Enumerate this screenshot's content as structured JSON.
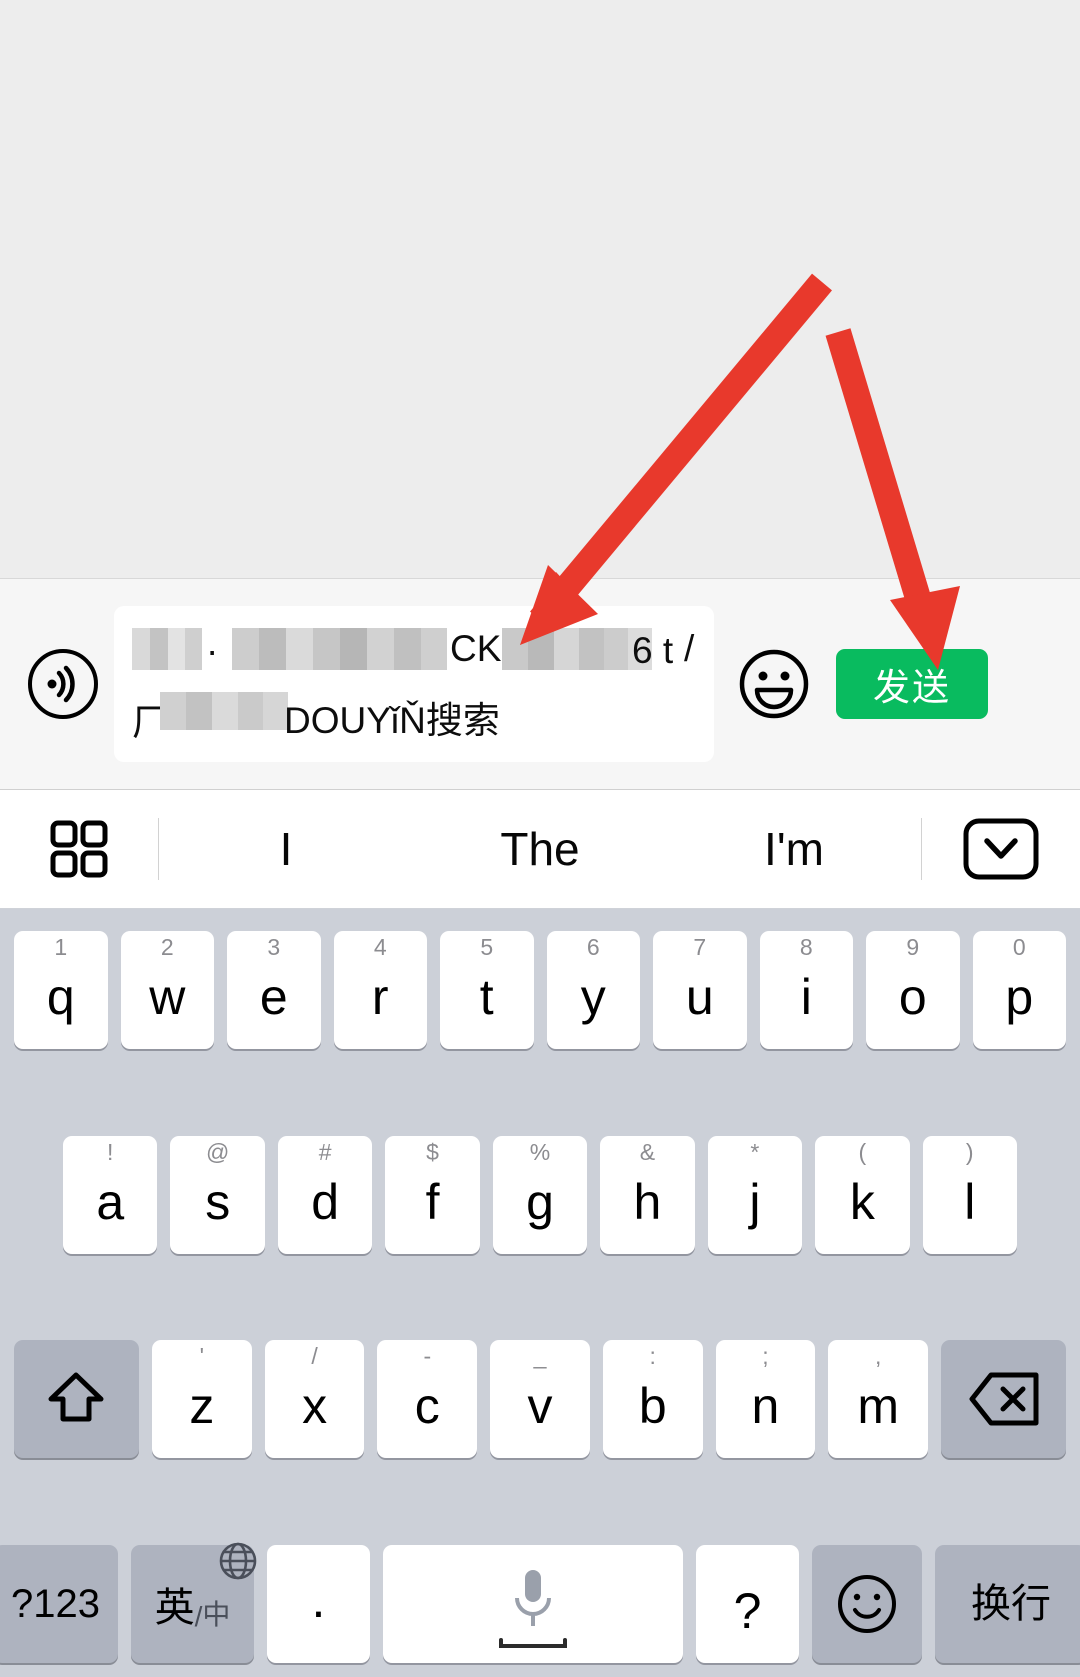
{
  "app": {
    "name": "wechat-chat-input",
    "accent_green": "#09bb5f",
    "keyboard_bg": "#ccd0d8",
    "key_fn_bg": "#aeb3bf",
    "arrow_color": "#e8392c"
  },
  "chat": {
    "background": "#ededed",
    "messages": []
  },
  "input_bar": {
    "voice_icon": "voice-wave-icon",
    "emoji_icon": "smiley-face-icon",
    "send_label": "发送",
    "composed_text": {
      "line1_visible_fragments": [
        "·",
        "CK",
        "6 t",
        "/"
      ],
      "line2_visible_fragments": [
        "厂",
        "DOUYǐŇ搜索"
      ],
      "redacted": true
    }
  },
  "suggestions": {
    "grid_icon": "grid-apps-icon",
    "words": [
      "I",
      "The",
      "I'm"
    ],
    "collapse_icon": "chevron-down-box-icon"
  },
  "keyboard": {
    "row1": [
      {
        "hint": "1",
        "main": "q"
      },
      {
        "hint": "2",
        "main": "w"
      },
      {
        "hint": "3",
        "main": "e"
      },
      {
        "hint": "4",
        "main": "r"
      },
      {
        "hint": "5",
        "main": "t"
      },
      {
        "hint": "6",
        "main": "y"
      },
      {
        "hint": "7",
        "main": "u"
      },
      {
        "hint": "8",
        "main": "i"
      },
      {
        "hint": "9",
        "main": "o"
      },
      {
        "hint": "0",
        "main": "p"
      }
    ],
    "row2": [
      {
        "hint": "!",
        "main": "a"
      },
      {
        "hint": "@",
        "main": "s"
      },
      {
        "hint": "#",
        "main": "d"
      },
      {
        "hint": "$",
        "main": "f"
      },
      {
        "hint": "%",
        "main": "g"
      },
      {
        "hint": "&",
        "main": "h"
      },
      {
        "hint": "*",
        "main": "j"
      },
      {
        "hint": "(",
        "main": "k"
      },
      {
        "hint": ")",
        "main": "l"
      }
    ],
    "row3": {
      "shift_icon": "shift-up-arrow-icon",
      "keys": [
        {
          "hint": "'",
          "main": "z"
        },
        {
          "hint": "/",
          "main": "x"
        },
        {
          "hint": "-",
          "main": "c"
        },
        {
          "hint": "_",
          "main": "v"
        },
        {
          "hint": ":",
          "main": "b"
        },
        {
          "hint": ";",
          "main": "n"
        },
        {
          "hint": ",",
          "main": "m"
        }
      ],
      "backspace_icon": "backspace-delete-icon"
    },
    "row4": {
      "numbers_label": "?123",
      "lang_label_primary": "英",
      "lang_label_separator": "/",
      "lang_label_secondary": "中",
      "globe_icon": "globe-language-icon",
      "period_label": "·",
      "space_mic_icon": "microphone-icon",
      "question_label": "?",
      "emoji_icon": "smiley-outline-icon",
      "return_label": "换行"
    }
  },
  "annotations": {
    "arrows": [
      {
        "name": "arrow-to-input-field",
        "target": "text-field"
      },
      {
        "name": "arrow-to-send-button",
        "target": "send-button"
      }
    ]
  }
}
